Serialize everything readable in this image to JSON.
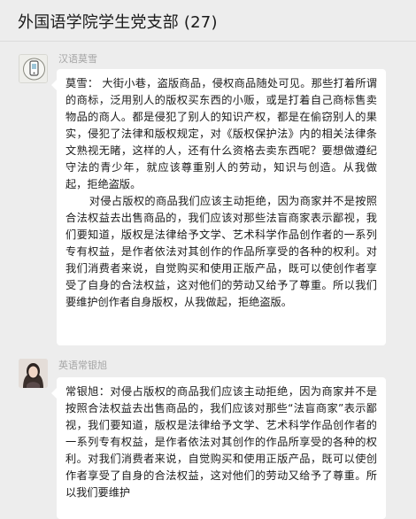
{
  "header": {
    "title": "外国语学院学生党支部 (27)"
  },
  "messages": [
    {
      "sender": "汉语莫雪",
      "paragraphs": [
        "莫雪： 大街小巷，盗版商品，侵权商品随处可见。那些打着所谓的商标，泛用别人的版权买东西的小贩，或是打着自己商标售卖物品的商人。都是侵犯了别人的知识产权，都是在偷窃别人的果实，侵犯了法律和版权规定，对《版权保护法》内的相关法律条文熟视无睹，这样的人，还有什么资格去卖东西呢？要想做遵纪守法的青少年，就应该尊重别人的劳动，知识与创造。从我做起，拒绝盗版。",
        "对侵占版权的商品我们应该主动拒绝，因为商家并不是按照合法权益去出售商品的，我们应该对那些法盲商家表示鄙视，我们要知道，版权是法律给予文学、艺术科学作品创作者的一系列专有权益，是作者依法对其创作的作品所享受的各种的权利。对我们消费者来说，自觉购买和使用正版产品，既可以使创作者享受了自身的合法权益，这对他们的劳动又给予了尊重。所以我们要维护创作者自身版权，从我做起，拒绝盗版。"
      ]
    },
    {
      "sender": "英语常银旭",
      "paragraphs": [
        "常银旭：对侵占版权的商品我们应该主动拒绝，因为商家并不是按照合法权益去出售商品的，我们应该对那些“法盲商家”表示鄙视，我们要知道，版权是法律给予文学、艺术科学作品创作者的一系列专有权益，是作者依法对其创作的作品所享受的各种的权利。对我们消费者来说，自觉购买和使用正版产品，既可以使创作者享受了自身的合法权益，这对他们的劳动又给予了尊重。所以我们要维护"
      ]
    }
  ]
}
